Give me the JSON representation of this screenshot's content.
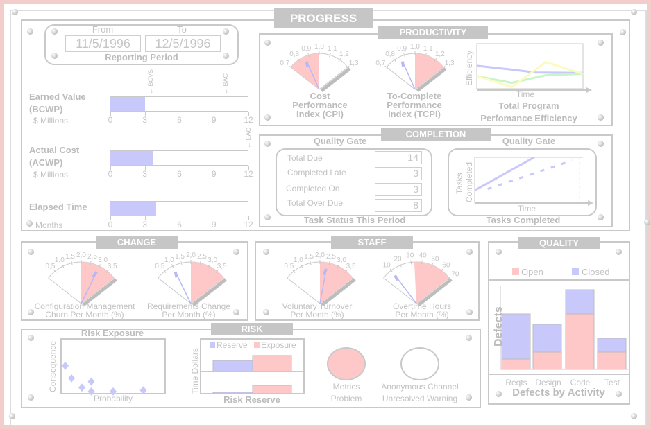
{
  "title": "PROGRESS",
  "colors": {
    "alarm": "#ffc8c8",
    "actual": "#c8c8fb",
    "panel_border": "#c9c9c9",
    "frame": "#f3cccc",
    "header_bg": "#c6c6c6"
  },
  "reporting_period": {
    "from_label": "From",
    "to_label": "To",
    "from": "11/5/1996",
    "to": "12/5/1996",
    "caption": "Reporting Period"
  },
  "progress_axis": {
    "max": 12,
    "ticks": [
      "0",
      "3",
      "6",
      "9",
      "12"
    ]
  },
  "earned_value": {
    "line1": "Earned Value",
    "line2": "(BCWP)",
    "unit": "$ Millions",
    "value": 3.0,
    "markers": [
      {
        "label": "BCVS",
        "value": 3.5
      },
      {
        "label": "BAC",
        "value": 10
      }
    ]
  },
  "actual_cost": {
    "line1": "Actual Cost",
    "line2": "(ACWP)",
    "unit": "$ Millions",
    "value": 3.7,
    "markers": [
      {
        "label": "EAC",
        "value": 12
      }
    ]
  },
  "elapsed_time": {
    "line1": "Elapsed Time",
    "unit": "Months",
    "value": 4.0
  },
  "productivity": {
    "title": "PRODUCTIVITY",
    "cpi": {
      "caption": [
        "Cost",
        "Performance",
        "Index (CPI)"
      ],
      "min": 0.7,
      "max": 1.3,
      "alarm": [
        0.7,
        1.0
      ],
      "needle": 0.86,
      "ticks": [
        {
          "v": 0.7,
          "l": "0,7"
        },
        {
          "v": 0.8,
          "l": "0,8"
        },
        {
          "v": 0.9,
          "l": "0,9"
        },
        {
          "v": 1.0,
          "l": "1,0"
        },
        {
          "v": 1.1,
          "l": "1,1"
        },
        {
          "v": 1.2,
          "l": "1,2"
        },
        {
          "v": 1.3,
          "l": "1,3"
        }
      ]
    },
    "tcpi": {
      "caption": [
        "To-Complete",
        "Performance",
        "Index (TCPI)"
      ],
      "min": 0.7,
      "max": 1.3,
      "alarm": [
        1.0,
        1.3
      ],
      "needle": 0.86,
      "ticks": [
        {
          "v": 0.7,
          "l": "0,7"
        },
        {
          "v": 0.8,
          "l": "0,8"
        },
        {
          "v": 0.9,
          "l": "0,9"
        },
        {
          "v": 1.0,
          "l": "1,0"
        },
        {
          "v": 1.1,
          "l": "1,1"
        },
        {
          "v": 1.2,
          "l": "1,2"
        },
        {
          "v": 1.3,
          "l": "1,3"
        }
      ]
    },
    "efficiency": {
      "ylabel": "Efficiency",
      "xlabel": "Time",
      "caption": [
        "Total Program",
        "Perfomance Efficiency"
      ],
      "series": [
        {
          "color": "#c8c8fb",
          "points": [
            [
              0,
              0.51
            ],
            [
              0.35,
              0.42
            ],
            [
              0.55,
              0.36
            ],
            [
              1,
              0.35
            ]
          ]
        },
        {
          "color": "#c8f5c8",
          "points": [
            [
              0,
              0.28
            ],
            [
              0.33,
              0.13
            ],
            [
              0.65,
              0.3
            ],
            [
              1,
              0.33
            ]
          ]
        },
        {
          "color": "#fbfbc0",
          "points": [
            [
              0,
              0.28
            ],
            [
              0.33,
              0.04
            ],
            [
              0.65,
              0.59
            ],
            [
              1,
              0.33
            ]
          ]
        }
      ]
    }
  },
  "completion": {
    "title": "COMPLETION",
    "gate_left": "Quality Gate",
    "gate_right": "Quality Gate",
    "task_status": {
      "caption": "Task Status This Period",
      "rows": [
        {
          "label": "Total Due",
          "value": "14"
        },
        {
          "label": "Completed Late",
          "value": "3"
        },
        {
          "label": "Completed On",
          "value": "3"
        },
        {
          "label": "Total Over Due",
          "value": "8"
        }
      ]
    },
    "tasks_completed": {
      "ylabel1": "Tasks",
      "ylabel2": "Completed",
      "xlabel": "Time",
      "caption": "Tasks Completed",
      "actual": [
        [
          0,
          0.28
        ],
        [
          0.55,
          1.0
        ]
      ],
      "planned": [
        [
          0.12,
          0.31
        ],
        [
          0.9,
          0.93
        ]
      ],
      "gate": 0.97
    }
  },
  "change": {
    "title": "CHANGE",
    "gauges": [
      {
        "caption": [
          "Configuration Management",
          "Churn Per Month (%)"
        ],
        "min": 0,
        "max": 4,
        "alarm": [
          2.0,
          4.0
        ],
        "needle": 3.0,
        "ticks": [
          {
            "v": 0.5,
            "l": "0,5"
          },
          {
            "v": 1.0,
            "l": "1,0"
          },
          {
            "v": 1.5,
            "l": "1,5"
          },
          {
            "v": 2.0,
            "l": "2,0"
          },
          {
            "v": 2.5,
            "l": "2,5"
          },
          {
            "v": 3.0,
            "l": "3,0"
          },
          {
            "v": 3.5,
            "l": "3,5"
          }
        ]
      },
      {
        "caption": [
          "Requirements Change",
          "Per Month (%)"
        ],
        "min": 0,
        "max": 4,
        "alarm": [
          2.0,
          4.0
        ],
        "needle": 1.0,
        "ticks": [
          {
            "v": 0.5,
            "l": "0,5"
          },
          {
            "v": 1.0,
            "l": "1,0"
          },
          {
            "v": 1.5,
            "l": "1,5"
          },
          {
            "v": 2.0,
            "l": "2,0"
          },
          {
            "v": 2.5,
            "l": "2,5"
          },
          {
            "v": 3.0,
            "l": "3,0"
          },
          {
            "v": 3.5,
            "l": "3,5"
          }
        ]
      }
    ]
  },
  "staff": {
    "title": "STAFF",
    "gauges": [
      {
        "caption": [
          "Voluntary Turnover",
          "Per Month (%)"
        ],
        "min": 0,
        "max": 4,
        "alarm": [
          2.0,
          4.0
        ],
        "needle": 2.4,
        "ticks": [
          {
            "v": 0.5,
            "l": "0,5"
          },
          {
            "v": 1.0,
            "l": "1,0"
          },
          {
            "v": 1.5,
            "l": "1,5"
          },
          {
            "v": 2.0,
            "l": "2,0"
          },
          {
            "v": 2.5,
            "l": "2,5"
          },
          {
            "v": 3.0,
            "l": "3,0"
          },
          {
            "v": 3.5,
            "l": "3,5"
          }
        ]
      },
      {
        "caption": [
          "Overtime Hours",
          "Per Month (%)"
        ],
        "min": 0,
        "max": 70,
        "alarm": [
          33,
          70
        ],
        "needle": 10,
        "ticks": [
          {
            "v": 10,
            "l": "10"
          },
          {
            "v": 20,
            "l": "20"
          },
          {
            "v": 30,
            "l": "30"
          },
          {
            "v": 40,
            "l": "40"
          },
          {
            "v": 50,
            "l": "50"
          },
          {
            "v": 60,
            "l": "60"
          },
          {
            "v": 70,
            "l": "70"
          }
        ]
      }
    ]
  },
  "quality": {
    "title": "QUALITY",
    "legend": {
      "open": "Open",
      "closed": "Closed"
    },
    "ylabel": "Defects",
    "caption": "Defects by Activity",
    "ymax": 26,
    "categories": [
      "Reqts",
      "Design",
      "Code",
      "Test"
    ],
    "open": [
      3,
      5,
      16,
      5
    ],
    "closed": [
      13,
      8,
      7,
      4
    ]
  },
  "risk": {
    "title": "RISK",
    "exposure": {
      "title": "Risk Exposure",
      "ylabel": "Consequence",
      "xlabel": "Probability",
      "points": [
        [
          0.04,
          0.51
        ],
        [
          0.1,
          0.28
        ],
        [
          0.2,
          0.11
        ],
        [
          0.29,
          0.22
        ],
        [
          0.29,
          0.04
        ],
        [
          0.5,
          0.04
        ],
        [
          0.79,
          0.06
        ]
      ]
    },
    "reserve": {
      "title": "Risk Reserve",
      "ylabel": "Time  Dollars",
      "legend": {
        "reserve": "Reserve",
        "exposure": "Exposure"
      },
      "dollars": {
        "reserve": 5.3,
        "exposure": 7.7
      },
      "time": {
        "reserve": 0.7,
        "exposure": 4.0
      },
      "max": 10
    },
    "metrics": {
      "line1": "Metrics",
      "line2": "Problem",
      "status": "alarm"
    },
    "anonymous": {
      "line1": "Anonymous Channel",
      "line2": "Unresolved Warning",
      "status": "ok"
    }
  }
}
